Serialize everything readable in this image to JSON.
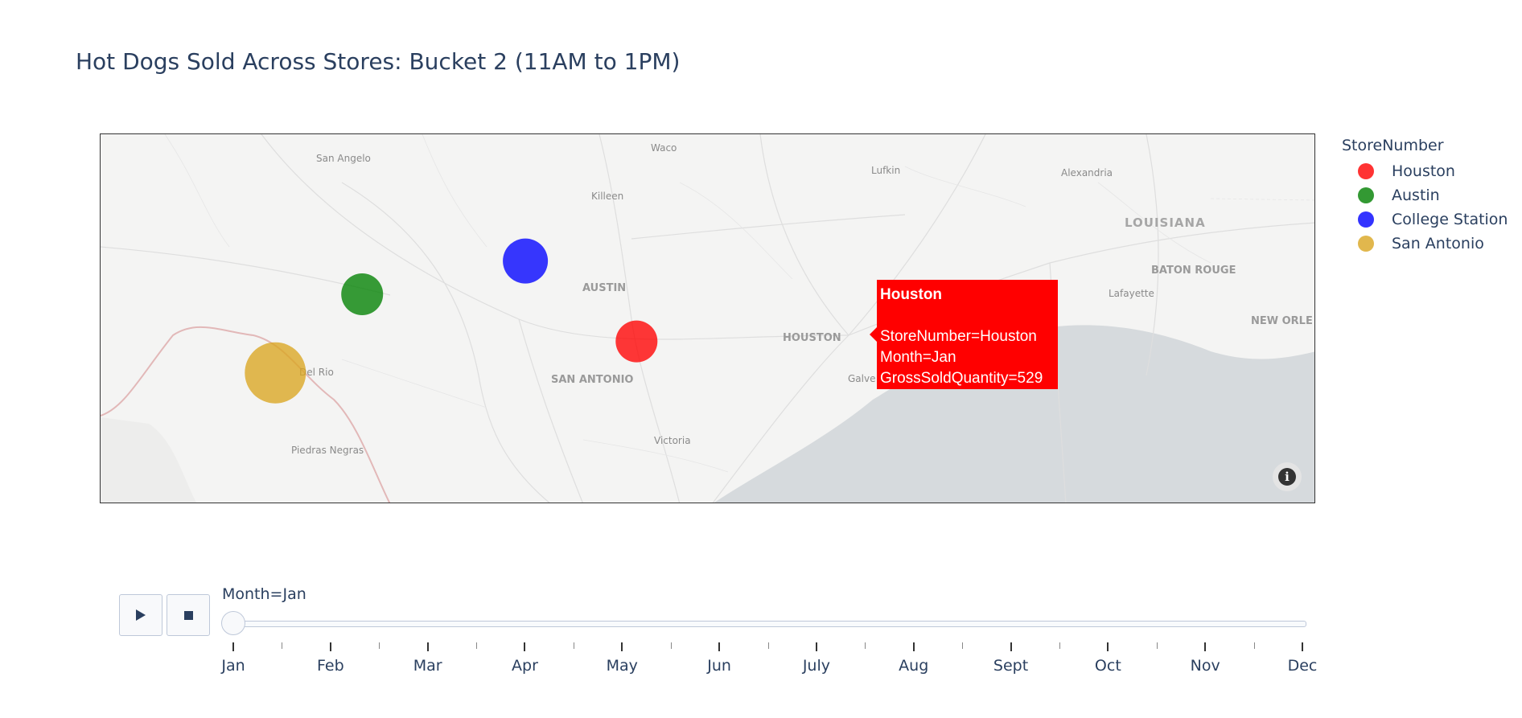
{
  "title": "Hot Dogs Sold Across Stores: Bucket 2 (11AM to 1PM)",
  "map": {
    "place_labels": [
      {
        "text": "San Angelo",
        "kind": "city"
      },
      {
        "text": "Waco",
        "kind": "city"
      },
      {
        "text": "Lufkin",
        "kind": "city"
      },
      {
        "text": "Alexandria",
        "kind": "city"
      },
      {
        "text": "Killeen",
        "kind": "city"
      },
      {
        "text": "LOUISIANA",
        "kind": "state"
      },
      {
        "text": "BATON ROUGE",
        "kind": "big"
      },
      {
        "text": "AUSTIN",
        "kind": "big"
      },
      {
        "text": "Lafayette",
        "kind": "city"
      },
      {
        "text": "NEW ORLE",
        "kind": "big"
      },
      {
        "text": "HOUSTON",
        "kind": "big"
      },
      {
        "text": "Del Rio",
        "kind": "city"
      },
      {
        "text": "SAN ANTONIO",
        "kind": "big"
      },
      {
        "text": "Galve",
        "kind": "city"
      },
      {
        "text": "Victoria",
        "kind": "city"
      },
      {
        "text": "Piedras Negras",
        "kind": "city"
      }
    ],
    "info_icon": "info-icon"
  },
  "chart_data": {
    "type": "scatter_mapbox",
    "title": "Hot Dogs Sold Across Stores: Bucket 2 (11AM to 1PM)",
    "legend_title": "StoreNumber",
    "frame": "Month=Jan",
    "series": [
      {
        "name": "Houston",
        "color": "#ff0000",
        "lat": 29.76,
        "lon": -95.37,
        "size_field": "GrossSoldQuantity",
        "value": 529
      },
      {
        "name": "Austin",
        "color": "#008000",
        "lat": 30.27,
        "lon": -97.74
      },
      {
        "name": "College Station",
        "color": "#0000ff",
        "lat": 30.63,
        "lon": -96.33
      },
      {
        "name": "San Antonio",
        "color": "#daa520",
        "lat": 29.42,
        "lon": -98.49
      }
    ]
  },
  "legend": {
    "title": "StoreNumber",
    "items": [
      {
        "label": "Houston",
        "color": "#ff0000"
      },
      {
        "label": "Austin",
        "color": "#008000"
      },
      {
        "label": "College Station",
        "color": "#0000ff"
      },
      {
        "label": "San Antonio",
        "color": "#daa520"
      }
    ]
  },
  "tooltip": {
    "title": "Houston",
    "line1": "StoreNumber=Houston",
    "line2": "Month=Jan",
    "line3": "GrossSoldQuantity=529",
    "color": "#ff0000"
  },
  "slider": {
    "current": "Month=Jan",
    "months": [
      "Jan",
      "Feb",
      "Mar",
      "Apr",
      "May",
      "Jun",
      "July",
      "Aug",
      "Sept",
      "Oct",
      "Nov",
      "Dec"
    ],
    "selected_index": 0
  }
}
